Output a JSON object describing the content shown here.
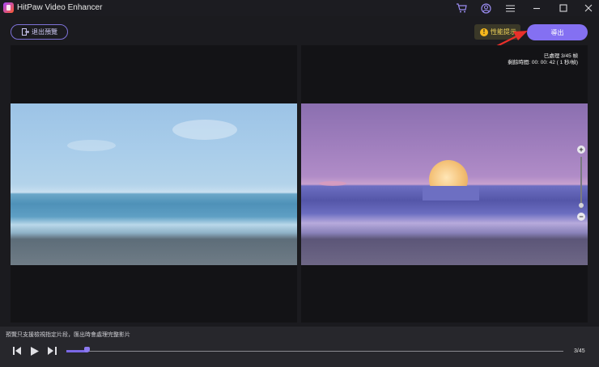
{
  "window": {
    "title": "HitPaw Video Enhancer",
    "icons": [
      "cart-icon",
      "account-icon",
      "menu-icon",
      "minimize-icon",
      "maximize-icon",
      "close-icon"
    ]
  },
  "toolbar": {
    "exit_label": "退出預覽",
    "perf_label": "性能提示",
    "perf_icon_glyph": "!",
    "export_label": "導出"
  },
  "preview": {
    "processed_label": "已處理 3/45 幀",
    "remaining_label": "剩餘時間: 00: 00: 42 ( 1 秒/幀)",
    "zoom_plus": "+",
    "zoom_minus": "−"
  },
  "footer": {
    "notice": "預覽只支援檢視指定片段，匯出時會處理完整影片",
    "frame_counter": "3/45",
    "progress": 0.04
  },
  "colors": {
    "accent": "#8470f2",
    "warning": "#f5b81d",
    "arrow": "#e8302a"
  }
}
